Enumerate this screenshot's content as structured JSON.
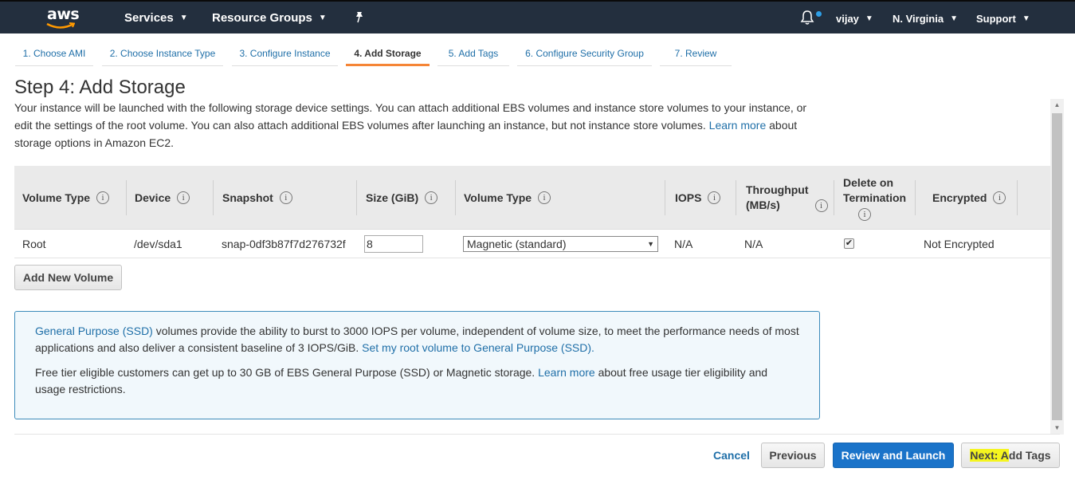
{
  "nav": {
    "logo": "aws",
    "services": "Services",
    "resource_groups": "Resource Groups",
    "user": "vijay",
    "region": "N. Virginia",
    "support": "Support"
  },
  "tabs": [
    "1. Choose AMI",
    "2. Choose Instance Type",
    "3. Configure Instance",
    "4. Add Storage",
    "5. Add Tags",
    "6. Configure Security Group",
    "7. Review"
  ],
  "active_tab": 3,
  "page": {
    "title": "Step 4: Add Storage",
    "desc_part1": "Your instance will be launched with the following storage device settings. You can attach additional EBS volumes and instance store volumes to your instance, or edit the settings of the root volume. You can also attach additional EBS volumes after launching an instance, but not instance store volumes.",
    "desc_link": "Learn more",
    "desc_part2": "about storage options in Amazon EC2."
  },
  "table": {
    "headers": {
      "volume_type": "Volume Type",
      "device": "Device",
      "snapshot": "Snapshot",
      "size": "Size (GiB)",
      "ebs_type": "Volume Type",
      "iops": "IOPS",
      "throughput_line1": "Throughput",
      "throughput_line2": "(MB/s)",
      "delete_line1": "Delete on",
      "delete_line2": "Termination",
      "encrypted": "Encrypted"
    },
    "row": {
      "volume_type": "Root",
      "device": "/dev/sda1",
      "snapshot": "snap-0df3b87f7d276732f",
      "size": "8",
      "ebs_type": "Magnetic (standard)",
      "iops": "N/A",
      "throughput": "N/A",
      "delete_on_termination": true,
      "encrypted": "Not Encrypted"
    }
  },
  "add_volume_button": "Add New Volume",
  "info": {
    "p1_link": "General Purpose (SSD)",
    "p1_text": "volumes provide the ability to burst to 3000 IOPS per volume, independent of volume size, to meet the performance needs of most applications and also deliver a consistent baseline of 3 IOPS/GiB.",
    "p1_action": "Set my root volume to General Purpose (SSD).",
    "p2_text1": "Free tier eligible customers can get up to 30 GB of EBS General Purpose (SSD) or Magnetic storage.",
    "p2_link": "Learn more",
    "p2_text2": "about free usage tier eligibility and usage restrictions."
  },
  "footer": {
    "cancel": "Cancel",
    "previous": "Previous",
    "review_launch": "Review and Launch",
    "next_highlighted": "Next: A",
    "next_rest": "dd Tags"
  },
  "colors": {
    "nav_bg": "#232f3e",
    "link": "#1f6fa8",
    "active_tab_underline": "#f58536",
    "primary_button": "#1a73c9",
    "highlight": "#f5f51f"
  }
}
